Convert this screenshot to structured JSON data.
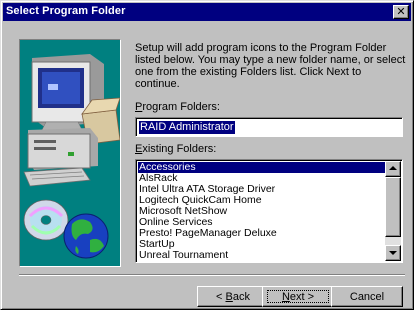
{
  "window": {
    "title": "Select Program Folder",
    "close_glyph": "✕"
  },
  "description": "Setup will add program icons to the Program Folder listed below. You may type a new folder name, or select one from the existing Folders list.  Click Next to continue.",
  "program_folders": {
    "label_first": "P",
    "label_rest": "rogram Folders:",
    "value": "RAID Administrator"
  },
  "existing_folders": {
    "label_first": "E",
    "label_rest": "xisting Folders:",
    "selected_index": 0,
    "items": [
      "Accessories",
      "AlsRack",
      "Intel Ultra ATA Storage Driver",
      "Logitech QuickCam Home",
      "Microsoft NetShow",
      "Online Services",
      "Presto! PageManager Deluxe",
      "StartUp",
      "Unreal Tournament"
    ]
  },
  "buttons": {
    "back_prefix": "< ",
    "back_accel": "B",
    "back_rest": "ack",
    "next_accel": "N",
    "next_rest": "ext >",
    "cancel": "Cancel"
  },
  "colors": {
    "face": "#c0c0c0",
    "title_bar": "#000080",
    "selection": "#000080",
    "art_background": "#008080"
  },
  "icons": [
    "close-icon",
    "computer-illustration",
    "cd-rom-disc-icon",
    "globe-icon",
    "scroll-up-arrow-icon",
    "scroll-down-arrow-icon"
  ]
}
